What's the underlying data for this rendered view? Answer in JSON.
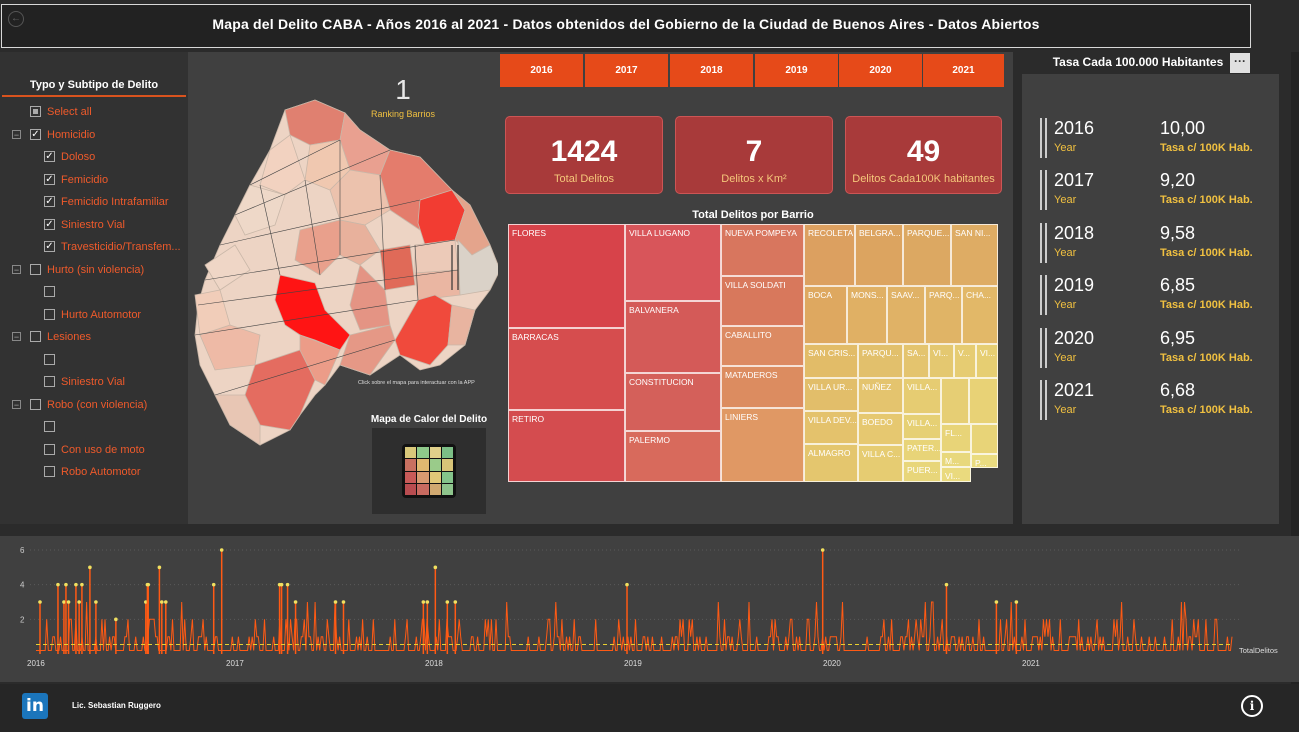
{
  "title": "Mapa del Delito CABA - Años 2016 al 2021 - Datos obtenidos del Gobierno de la Ciudad de Buenos Aires - Datos Abiertos",
  "filter": {
    "title": "Typo y Subtipo de Delito",
    "items": [
      {
        "label": "Select all",
        "level": 0,
        "expander": false,
        "checked": "partial"
      },
      {
        "label": "Homicidio",
        "level": 0,
        "expander": true,
        "checked": "yes"
      },
      {
        "label": "Doloso",
        "level": 1,
        "expander": false,
        "checked": "yes"
      },
      {
        "label": "Femicidio",
        "level": 1,
        "expander": false,
        "checked": "yes"
      },
      {
        "label": "Femicidio Intrafamiliar",
        "level": 1,
        "expander": false,
        "checked": "yes"
      },
      {
        "label": "Siniestro Vial",
        "level": 1,
        "expander": false,
        "checked": "yes"
      },
      {
        "label": "Travesticidio/Transfem...",
        "level": 1,
        "expander": false,
        "checked": "yes"
      },
      {
        "label": "Hurto (sin violencia)",
        "level": 0,
        "expander": true,
        "checked": "no"
      },
      {
        "label": "",
        "level": 1,
        "expander": false,
        "checked": "no"
      },
      {
        "label": "Hurto Automotor",
        "level": 1,
        "expander": false,
        "checked": "no"
      },
      {
        "label": "Lesiones",
        "level": 0,
        "expander": true,
        "checked": "no"
      },
      {
        "label": "",
        "level": 1,
        "expander": false,
        "checked": "no"
      },
      {
        "label": "Siniestro Vial",
        "level": 1,
        "expander": false,
        "checked": "no"
      },
      {
        "label": "Robo (con violencia)",
        "level": 0,
        "expander": true,
        "checked": "no"
      },
      {
        "label": "",
        "level": 1,
        "expander": false,
        "checked": "no"
      },
      {
        "label": "Con uso de moto",
        "level": 1,
        "expander": false,
        "checked": "no"
      },
      {
        "label": "Robo Automotor",
        "level": 1,
        "expander": false,
        "checked": "no"
      }
    ]
  },
  "ranking": {
    "value": "1",
    "label": "Ranking Barrios"
  },
  "map": {
    "hint": "Click sobre el mapa para interactuar con la APP"
  },
  "heatmap": {
    "title": "Mapa de Calor del Delito"
  },
  "years": [
    "2016",
    "2017",
    "2018",
    "2019",
    "2020",
    "2021"
  ],
  "kpis": [
    {
      "value": "1424",
      "label": "Total Delitos"
    },
    {
      "value": "7",
      "label": "Delitos x Km²"
    },
    {
      "value": "49",
      "label": "Delitos Cada100K habitantes"
    }
  ],
  "treemap": {
    "title": "Total Delitos por Barrio",
    "cells": [
      "FLORES",
      "BARRACAS",
      "RETIRO",
      "VILLA LUGANO",
      "BALVANERA",
      "CONSTITUCION",
      "PALERMO",
      "NUEVA POMPEYA",
      "VILLA SOLDATI",
      "CABALLITO",
      "MATADEROS",
      "LINIERS",
      "RECOLETA",
      "BELGRA...",
      "PARQUE...",
      "SAN NI...",
      "BOCA",
      "MONS...",
      "SAAV...",
      "PARQ...",
      "CHA...",
      "SAN CRIS...",
      "PARQU...",
      "SA...",
      "VI...",
      "V...",
      "VI...",
      "VILLA UR...",
      "NUÑEZ",
      "VILLA DEV...",
      "BOEDO",
      "ALMAGRO",
      "VILLA C...",
      "VILLA...",
      "VILLA...",
      "PATER...",
      "FL...",
      "PUER...",
      "M...",
      "VI...",
      "P..."
    ]
  },
  "tasa": {
    "title": "Tasa Cada 100.000 Habitantes",
    "more": "···",
    "rows": [
      {
        "year": "2016",
        "year_label": "Year",
        "rate": "10,00",
        "rate_label": "Tasa c/ 100K Hab."
      },
      {
        "year": "2017",
        "year_label": "Year",
        "rate": "9,20",
        "rate_label": "Tasa c/ 100K Hab."
      },
      {
        "year": "2018",
        "year_label": "Year",
        "rate": "9,58",
        "rate_label": "Tasa c/ 100K Hab."
      },
      {
        "year": "2019",
        "year_label": "Year",
        "rate": "6,85",
        "rate_label": "Tasa c/ 100K Hab."
      },
      {
        "year": "2020",
        "year_label": "Year",
        "rate": "6,95",
        "rate_label": "Tasa c/ 100K Hab."
      },
      {
        "year": "2021",
        "year_label": "Year",
        "rate": "6,68",
        "rate_label": "Tasa c/ 100K Hab."
      }
    ]
  },
  "chart_data": {
    "type": "line",
    "series": [
      {
        "name": "TotalDelitos"
      }
    ],
    "x_ticks": [
      "2016",
      "2017",
      "2018",
      "2019",
      "2020",
      "2021"
    ],
    "y_ticks": [
      "2",
      "4",
      "6"
    ],
    "ylim": [
      0,
      6
    ],
    "peaks": [
      {
        "x": 0.02,
        "y": 3
      },
      {
        "x": 0.11,
        "y": 4
      },
      {
        "x": 0.14,
        "y": 3
      },
      {
        "x": 0.15,
        "y": 4
      },
      {
        "x": 0.163,
        "y": 3
      },
      {
        "x": 0.2,
        "y": 4
      },
      {
        "x": 0.216,
        "y": 3
      },
      {
        "x": 0.23,
        "y": 4
      },
      {
        "x": 0.27,
        "y": 5
      },
      {
        "x": 0.3,
        "y": 3
      },
      {
        "x": 0.4,
        "y": 2
      },
      {
        "x": 0.55,
        "y": 3
      },
      {
        "x": 0.558,
        "y": 4
      },
      {
        "x": 0.562,
        "y": 4
      },
      {
        "x": 0.618,
        "y": 5
      },
      {
        "x": 0.63,
        "y": 3
      },
      {
        "x": 0.65,
        "y": 3
      },
      {
        "x": 0.89,
        "y": 4
      },
      {
        "x": 0.93,
        "y": 6
      },
      {
        "x": 1.22,
        "y": 4
      },
      {
        "x": 1.23,
        "y": 4
      },
      {
        "x": 1.26,
        "y": 4
      },
      {
        "x": 1.3,
        "y": 3
      },
      {
        "x": 1.5,
        "y": 3
      },
      {
        "x": 1.54,
        "y": 3
      },
      {
        "x": 1.94,
        "y": 3
      },
      {
        "x": 1.96,
        "y": 3
      },
      {
        "x": 2.0,
        "y": 5
      },
      {
        "x": 2.06,
        "y": 3
      },
      {
        "x": 2.1,
        "y": 3
      },
      {
        "x": 2.96,
        "y": 4
      },
      {
        "x": 3.94,
        "y": 6
      },
      {
        "x": 4.56,
        "y": 4
      },
      {
        "x": 4.81,
        "y": 3
      },
      {
        "x": 4.91,
        "y": 3
      }
    ],
    "reference_line": "dashed yellow average line"
  },
  "footer": {
    "author": "Lic. Sebastian Ruggero",
    "linkedin": "in",
    "info": "i"
  },
  "colors": {
    "accent": "#e64a19",
    "kpi_bg": "#a83a3a",
    "gold": "#f0c040",
    "line": "#ff5a14"
  }
}
